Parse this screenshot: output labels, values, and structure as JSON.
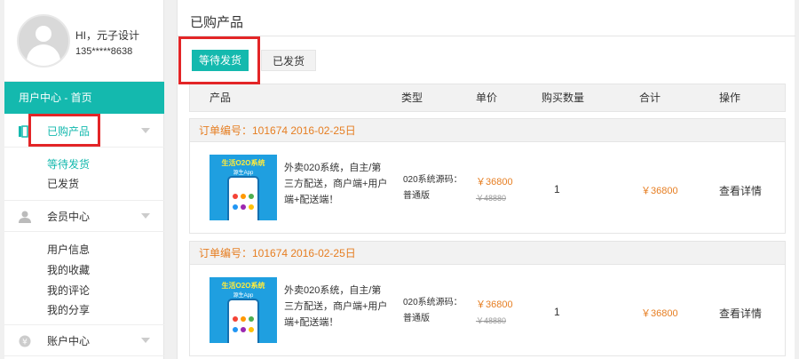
{
  "user": {
    "greeting": "HI，元子设计",
    "phone": "135*****8638"
  },
  "sidebar": {
    "uc_home": "用户中心 - 首页",
    "groups": [
      {
        "label": "已购产品",
        "icon": "orders-icon",
        "active": true,
        "items": [
          {
            "label": "等待发货",
            "active": true
          },
          {
            "label": "已发货",
            "active": false
          }
        ]
      },
      {
        "label": "会员中心",
        "icon": "user-icon",
        "items": [
          {
            "label": "用户信息"
          },
          {
            "label": "我的收藏"
          },
          {
            "label": "我的评论"
          },
          {
            "label": "我的分享"
          }
        ]
      },
      {
        "label": "账户中心",
        "icon": "account-icon",
        "items": []
      }
    ]
  },
  "main": {
    "title": "已购产品",
    "tabs": [
      {
        "label": "等待发货",
        "active": true
      },
      {
        "label": "已发货",
        "active": false
      }
    ],
    "columns": [
      "产品",
      "类型",
      "单价",
      "购买数量",
      "合计",
      "操作"
    ],
    "orders": [
      {
        "order_label": "订单编号：101674    2016-02-25日",
        "thumb_title": "生活O2O系统",
        "thumb_sub": "源生App",
        "desc": "外卖020系统，自主/第三方配送，商户端+用户端+配送端！",
        "type": "020系统源码：普通版",
        "price": "￥36800",
        "old_price": "￥48880",
        "qty": "1",
        "total": "￥36800",
        "action": "查看详情"
      },
      {
        "order_label": "订单编号：101674    2016-02-25日",
        "thumb_title": "生活O2O系统",
        "thumb_sub": "源生App",
        "desc": "外卖020系统，自主/第三方配送，商户端+用户端+配送端！",
        "type": "020系统源码：普通版",
        "price": "￥36800",
        "old_price": "￥48880",
        "qty": "1",
        "total": "￥36800",
        "action": "查看详情"
      }
    ]
  },
  "colors": {
    "accent": "#14b9ae",
    "highlight_box": "#e32527",
    "price": "#e67e22"
  }
}
